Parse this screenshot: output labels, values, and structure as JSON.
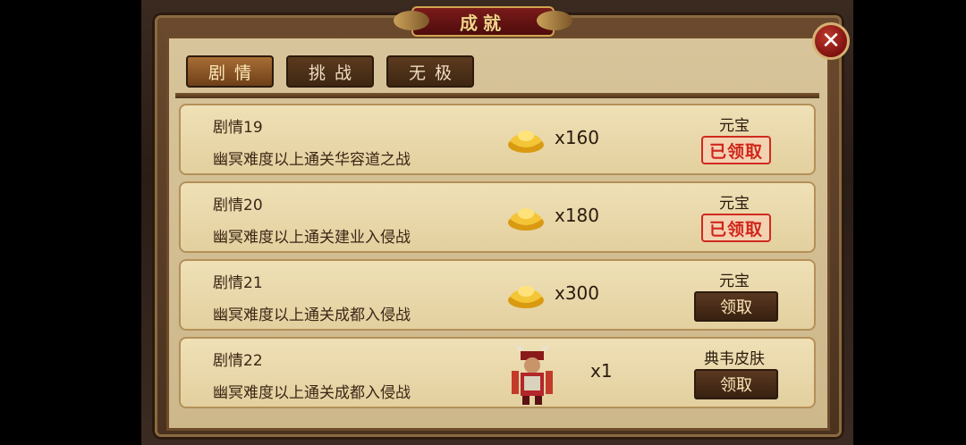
{
  "window": {
    "title": "成就",
    "close_symbol": "✕"
  },
  "tabs": [
    {
      "label": "剧情",
      "active": true
    },
    {
      "label": "挑战",
      "active": false
    },
    {
      "label": "无极",
      "active": false
    }
  ],
  "achievements": [
    {
      "name": "剧情19",
      "description": "幽冥难度以上通关华容道之战",
      "reward_icon": "gold-ingot-icon",
      "quantity": "x160",
      "reward_type": "元宝",
      "status": "已领取"
    },
    {
      "name": "剧情20",
      "description": "幽冥难度以上通关建业入侵战",
      "reward_icon": "gold-ingot-icon",
      "quantity": "x180",
      "reward_type": "元宝",
      "status": "已领取"
    },
    {
      "name": "剧情21",
      "description": "幽冥难度以上通关成都入侵战",
      "reward_icon": "gold-ingot-icon",
      "quantity": "x300",
      "reward_type": "元宝",
      "status": "领取"
    },
    {
      "name": "剧情22",
      "description": "幽冥难度以上通关成都入侵战",
      "reward_icon": "hero-skin-icon",
      "quantity": "x1",
      "reward_type": "典韦皮肤",
      "status": "领取"
    }
  ],
  "colors": {
    "claimed_red": "#d0261b",
    "button_brown": "#3e2612",
    "title_red": "#7a1a1a"
  }
}
